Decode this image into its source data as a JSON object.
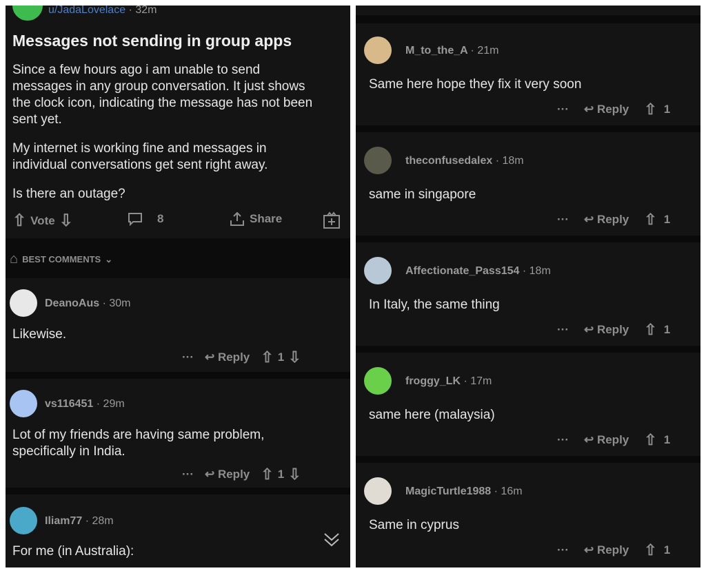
{
  "post": {
    "author": "u/JadaLovelace",
    "time": "· 32m",
    "title": "Messages not sending in group apps",
    "body": [
      "Since a few hours ago i am unable to send",
      "messages in any group conversation. It just shows",
      "the clock icon, indicating the message has not been",
      "sent yet."
    ],
    "body2": [
      "My internet is working fine and messages in",
      "individual conversations get sent right away."
    ],
    "body3": "Is there an outage?",
    "vote_label": "Vote",
    "comment_count": "8",
    "share_label": "Share"
  },
  "sort": {
    "label": "BEST COMMENTS"
  },
  "left_comments": [
    {
      "user": "DeanoAus",
      "time": "· 30m",
      "text": [
        "Likewise."
      ],
      "votes": "1",
      "avatar_color": "#e8e8e8"
    },
    {
      "user": "vs116451",
      "time": "· 29m",
      "text": [
        "Lot of my friends are having same problem,",
        "specifically in India."
      ],
      "votes": "1",
      "avatar_color": "#a7c4f2"
    },
    {
      "user": "Iliam77",
      "time": "· 28m",
      "text": [
        "For me (in Australia):"
      ],
      "avatar_color": "#4aa8c9"
    }
  ],
  "right_comments": [
    {
      "user": "M_to_the_A",
      "time": "· 21m",
      "text": "Same here hope they fix it very soon",
      "votes": "1",
      "avatar_color": "#d8b98a"
    },
    {
      "user": "theconfusedalex",
      "time": "· 18m",
      "text": "same in singapore",
      "votes": "1",
      "avatar_color": "#5a5a4a"
    },
    {
      "user": "Affectionate_Pass154",
      "time": "· 18m",
      "text": "In Italy, the same thing",
      "votes": "1",
      "avatar_color": "#b9c8d6"
    },
    {
      "user": "froggy_LK",
      "time": "· 17m",
      "text": "same here (malaysia)",
      "votes": "1",
      "avatar_color": "#6ad04a"
    },
    {
      "user": "MagicTurtle1988",
      "time": "· 16m",
      "text": "Same in cyprus",
      "votes": "1",
      "avatar_color": "#e0dcd4"
    }
  ],
  "reply_label": "Reply",
  "more_label": "···",
  "colors": {
    "bg": "#141414",
    "author_link": "#4f7ec4",
    "whatsapp": "#3dbb4e"
  }
}
